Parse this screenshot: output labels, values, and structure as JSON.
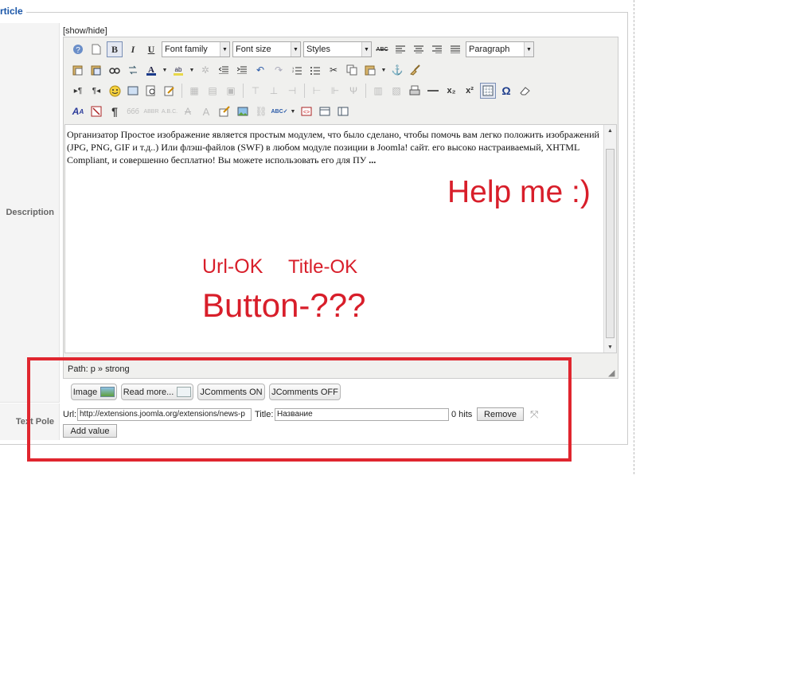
{
  "fieldset": {
    "legend": "rticle"
  },
  "labels": {
    "description": "Description",
    "text_pole": "Text Pole"
  },
  "editor": {
    "show_hide": "[show/hide]",
    "toolbar": {
      "bold": "B",
      "italic": "I",
      "underline": "U",
      "strike": "ABC",
      "font_family": "Font family",
      "font_size": "Font size",
      "styles": "Styles",
      "paragraph": "Paragraph",
      "pilcrow": "¶",
      "subscript": "x₂",
      "superscript": "x²",
      "omega": "Ω"
    },
    "content": "Организатор Простое изображение является простым модулем, что было сделано, чтобы помочь вам легко положить изображений (JPG, PNG, GIF и т.д..) Или флэш-файлов (SWF) в любом модуле позиции в Joomla! сайт. его высоко настраиваемый, XHTML Compliant, и совершенно бесплатно! Вы можете использовать его для ПУ",
    "content_bold": "...",
    "path": "Path: p » strong"
  },
  "buttons": {
    "image": "Image",
    "read_more": "Read more...",
    "jcomments_on": "JComments ON",
    "jcomments_off": "JComments OFF"
  },
  "text_pole": {
    "url_label": "Url:",
    "url_value": "http://extensions.joomla.org/extensions/news-p",
    "title_label": "Title:",
    "title_value": "Название",
    "hits": "0 hits",
    "remove": "Remove",
    "add_value": "Add value"
  },
  "annotations": {
    "help": "Help me :)",
    "url_ok": "Url-OK",
    "title_ok": "Title-OK",
    "button_q": "Button-???"
  },
  "colors": {
    "annotation": "#d81e2a",
    "legend": "#1a56a8"
  }
}
